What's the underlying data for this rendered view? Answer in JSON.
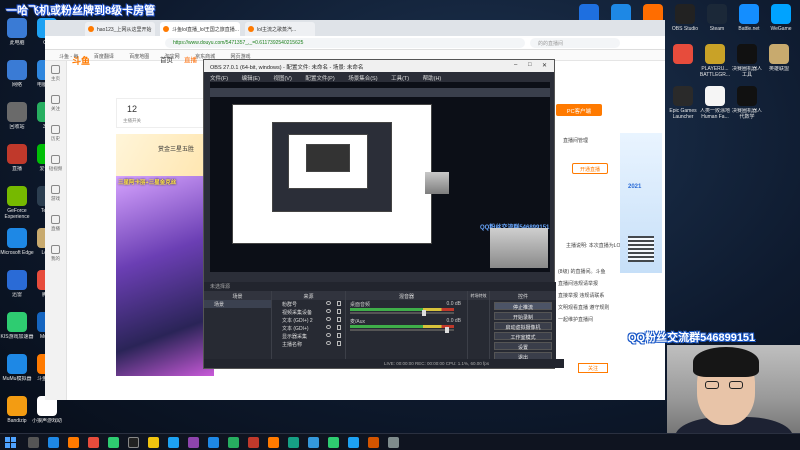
{
  "overlay": {
    "top_banner": "一哈飞机或粉丝牌到8级卡房管",
    "qq_group": "QQ粉丝交流群546899151"
  },
  "desktop_left": [
    {
      "label": "此电脑",
      "icon": "computer-icon",
      "color": "#3a7bd5"
    },
    {
      "label": "网络",
      "icon": "network-icon",
      "color": "#3a7bd5"
    },
    {
      "label": "回收站",
      "icon": "recycle-bin-icon",
      "color": "#6a6a6a"
    },
    {
      "label": "直播",
      "icon": "live-icon",
      "color": "#c0392b"
    },
    {
      "label": "GeForce Experience",
      "icon": "nvidia-icon",
      "color": "#76b900"
    },
    {
      "label": "Microsoft Edge",
      "icon": "edge-icon",
      "color": "#1e88e5"
    },
    {
      "label": "迅雷",
      "icon": "thunder-icon",
      "color": "#2a6bd6"
    },
    {
      "label": "KIS游戏加速器",
      "icon": "game-accel-icon",
      "color": "#2ecc71"
    },
    {
      "label": "MuMu模拟器",
      "icon": "mumu-icon",
      "color": "#1e88e5"
    },
    {
      "label": "Bandizip",
      "icon": "bandizip-icon",
      "color": "#f39c12"
    }
  ],
  "desktop_col2": [
    {
      "label": "QQ",
      "icon": "qq-icon",
      "color": "#1da1f2"
    },
    {
      "label": "电脑管家",
      "icon": "shield-icon",
      "color": "#2e86de"
    },
    {
      "label": "360",
      "icon": "360-icon",
      "color": "#27ae60"
    },
    {
      "label": "爱奇艺",
      "icon": "iqiyi-icon",
      "color": "#00be06"
    },
    {
      "label": "Team",
      "icon": "team-icon",
      "color": "#2c3e50"
    },
    {
      "label": "Leag",
      "icon": "league-icon",
      "color": "#c8aa6e"
    },
    {
      "label": "腾讯",
      "icon": "tencent-icon",
      "color": "#e74c3c"
    },
    {
      "label": "MuMu",
      "icon": "mumu2-icon",
      "color": "#1565c0"
    },
    {
      "label": "斗鱼直播",
      "icon": "douyu-icon",
      "color": "#ff7a00"
    },
    {
      "label": "小狼声游戏助",
      "icon": "wolf-icon",
      "color": "#ffffff"
    }
  ],
  "desktop_right_row1": [
    {
      "label": "",
      "icon": "k-app-icon",
      "color": "#1e6fe0"
    },
    {
      "label": "",
      "icon": "star-app-icon",
      "color": "#1e88e5"
    },
    {
      "label": "",
      "icon": "fire-app-icon",
      "color": "#ff6d00"
    },
    {
      "label": "OBS Studio",
      "icon": "obs-icon",
      "color": "#222"
    },
    {
      "label": "Steam",
      "icon": "steam-icon",
      "color": "#1b2838"
    },
    {
      "label": "Battle.net",
      "icon": "battlenet-icon",
      "color": "#148eff"
    },
    {
      "label": "WeGame",
      "icon": "wegame-icon",
      "color": "#00a3ff"
    }
  ],
  "desktop_right_row2": [
    {
      "label": "",
      "icon": "doc-icon",
      "color": "#e74c3c"
    },
    {
      "label": "PLAYERU... BATTLEGR...",
      "icon": "pubg-icon",
      "color": "#c9a227"
    },
    {
      "label": "决赛圈机器人工具",
      "icon": "black-app-icon",
      "color": "#111"
    },
    {
      "label": "英雄联盟",
      "icon": "lol-icon",
      "color": "#c8aa6e"
    }
  ],
  "desktop_right_row3": [
    {
      "label": "Epic Games Launcher",
      "icon": "epic-icon",
      "color": "#2a2a2a"
    },
    {
      "label": "人类一败涂地 Human Fa...",
      "icon": "human-icon",
      "color": "#f5f5f5"
    },
    {
      "label": "决赛圈机器人代数学",
      "icon": "mw-icon",
      "color": "#111"
    }
  ],
  "browser": {
    "tabs": [
      "hao123_上网从这里开始",
      "斗鱼lol直播_lol王国之旅直播...",
      "lol主流之歌蒸汽..."
    ],
    "url": "https://www.douyu.com/5471357_,_=0.6117392540215625",
    "search_placeholder": "的的直播间",
    "bookmarks": [
      "斗鱼 - 每",
      "百度翻译",
      "百度地图",
      "淘宝网",
      "京东商城",
      "网页游戏"
    ],
    "sidebar": [
      "主页",
      "关注",
      "历史",
      "短视频",
      "游戏",
      "直播",
      "我的"
    ],
    "nav_logo": "斗鱼",
    "nav_home": "首页",
    "nav_live": "直播",
    "follow_count": "12",
    "follow_label": "主播开关",
    "banner_text": "赏金三星五胜",
    "video_title": "三星阿卡丽+三星金克丝",
    "pc_button": "PC客户端",
    "live_manage": "直播间管理",
    "start_live": "开通直播",
    "promo_year": "2021",
    "rp_lines": [
      "主播说明: 本次直播为LOL云顶之弈...",
      "(8级) 的直播间。斗鱼",
      "直播间违规请举报",
      "直接举报 违规请联系",
      "文明观看直播 遵守规则",
      "一起维护直播间"
    ],
    "bottom_btn": "关注"
  },
  "obs": {
    "title": "OBS 27.0.1 (64-bit, windows) - 配置文件: 未命名 - 场景: 未命名",
    "menu": [
      "文件(F)",
      "编辑(E)",
      "视图(V)",
      "配置文件(P)",
      "场景集合(S)",
      "工具(T)",
      "帮助(H)"
    ],
    "preview_qq": "QQ粉丝交流群546899151",
    "scene_header": "未选择源",
    "panels": {
      "scenes": "场景",
      "sources": "来源",
      "mixer": "混音器",
      "transitions": "转场特效",
      "controls": "控件"
    },
    "scene_items": [
      "场景"
    ],
    "sources": [
      "粉群号",
      "视频采集设备",
      "文本 (GDI+) 2",
      "文本 (GDI+)",
      "显示器采集",
      "主播名称"
    ],
    "mixer": [
      {
        "label": "桌面音频",
        "db": "0.0 dB",
        "level": 0.72
      },
      {
        "label": "麦/Aux",
        "db": "0.0 dB",
        "level": 0.95
      }
    ],
    "controls": [
      "停止推流",
      "开始录制",
      "启动虚拟摄像机",
      "工作室模式",
      "设置",
      "退出"
    ],
    "status": "LIVE: 00:00:00   REC: 00:00:00   CPU: 1.1%, 60.00 fps"
  },
  "colors": {
    "douyu_orange": "#ff7a00",
    "obs_bg": "#2b2e38",
    "overlay_blue": "#1a58c8"
  }
}
